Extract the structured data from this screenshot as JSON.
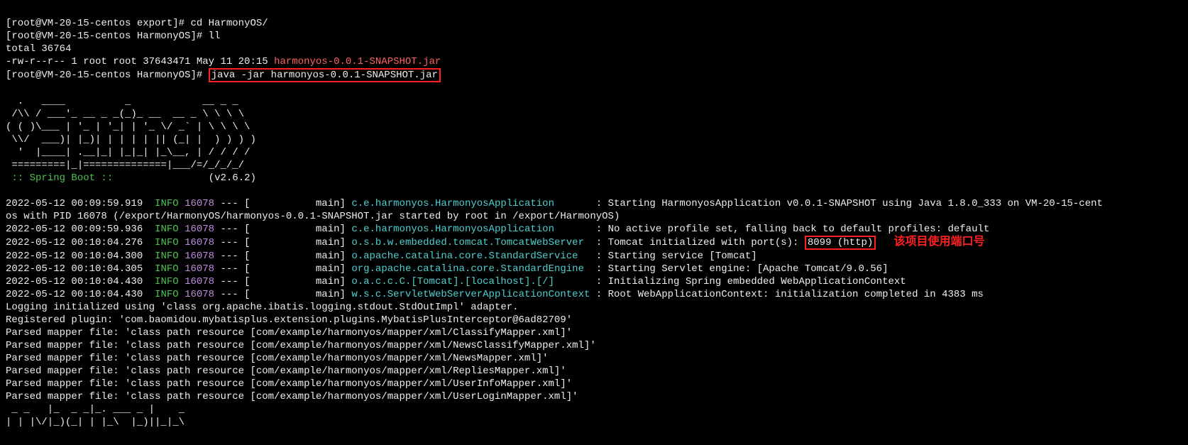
{
  "prompts": {
    "p1_prefix": "[root@VM-20-15-centos export]# ",
    "p1_cmd": "cd HarmonyOS/",
    "p2_prefix": "[root@VM-20-15-centos HarmonyOS]# ",
    "p2_cmd": "ll",
    "total": "total 36764",
    "ls_line_prefix": "-rw-r--r-- 1 root root 37643471 May 11 20:15 ",
    "ls_filename": "harmonyos-0.0.1-SNAPSHOT.jar",
    "p3_prefix": "[root@VM-20-15-centos HarmonyOS]# ",
    "p3_cmd": "java -jar harmonyos-0.0.1-SNAPSHOT.jar"
  },
  "ascii": {
    "l1": "  .   ____          _            __ _ _",
    "l2": " /\\\\ / ___'_ __ _ _(_)_ __  __ _ \\ \\ \\ \\",
    "l3": "( ( )\\___ | '_ | '_| | '_ \\/ _` | \\ \\ \\ \\",
    "l4": " \\\\/  ___)| |_)| | | | | || (_| |  ) ) ) )",
    "l5": "  '  |____| .__|_| |_|_| |_\\__, | / / / /",
    "l6": " =========|_|==============|___/=/_/_/_/"
  },
  "boot": {
    "label": " :: Spring Boot :: ",
    "spacer": "               ",
    "version": "(v2.6.2)"
  },
  "logs": [
    {
      "ts": "2022-05-12 00:09:59.919",
      "pid": "16078",
      "main": "main",
      "logger": "c.e.harmonyos.HarmonyosApplication      ",
      "msg_pre": ": Starting HarmonyosApplication v0.0.1-SNAPSHOT using Java 1.8.0_333 on VM-20-15-cent",
      "port": "",
      "msg_post": ""
    },
    {
      "cont": "os with PID 16078 (/export/HarmonyOS/harmonyos-0.0.1-SNAPSHOT.jar started by root in /export/HarmonyOS)"
    },
    {
      "ts": "2022-05-12 00:09:59.936",
      "pid": "16078",
      "main": "main",
      "logger": "c.e.harmonyos.HarmonyosApplication      ",
      "msg_pre": ": No active profile set, falling back to default profiles: default",
      "port": "",
      "msg_post": ""
    },
    {
      "ts": "2022-05-12 00:10:04.276",
      "pid": "16078",
      "main": "main",
      "logger": "o.s.b.w.embedded.tomcat.TomcatWebServer ",
      "msg_pre": ": Tomcat initialized with port(s): ",
      "port": "8099 (http)",
      "msg_post": "",
      "annot": "该项目使用端口号"
    },
    {
      "ts": "2022-05-12 00:10:04.300",
      "pid": "16078",
      "main": "main",
      "logger": "o.apache.catalina.core.StandardService  ",
      "msg_pre": ": Starting service [Tomcat]",
      "port": "",
      "msg_post": ""
    },
    {
      "ts": "2022-05-12 00:10:04.305",
      "pid": "16078",
      "main": "main",
      "logger": "org.apache.catalina.core.StandardEngine ",
      "msg_pre": ": Starting Servlet engine: [Apache Tomcat/9.0.56]",
      "port": "",
      "msg_post": ""
    },
    {
      "ts": "2022-05-12 00:10:04.430",
      "pid": "16078",
      "main": "main",
      "logger": "o.a.c.c.C.[Tomcat].[localhost].[/]      ",
      "msg_pre": ": Initializing Spring embedded WebApplicationContext",
      "port": "",
      "msg_post": ""
    },
    {
      "ts": "2022-05-12 00:10:04.430",
      "pid": "16078",
      "main": "main",
      "logger": "w.s.c.ServletWebServerApplicationContext",
      "msg_pre": ": Root WebApplicationContext: initialization completed in 4383 ms",
      "port": "",
      "msg_post": ""
    }
  ],
  "info_label": "INFO",
  "plain": [
    "Logging initialized using 'class org.apache.ibatis.logging.stdout.StdOutImpl' adapter.",
    "Registered plugin: 'com.baomidou.mybatisplus.extension.plugins.MybatisPlusInterceptor@6ad82709'",
    "Parsed mapper file: 'class path resource [com/example/harmonyos/mapper/xml/ClassifyMapper.xml]'",
    "Parsed mapper file: 'class path resource [com/example/harmonyos/mapper/xml/NewsClassifyMapper.xml]'",
    "Parsed mapper file: 'class path resource [com/example/harmonyos/mapper/xml/NewsMapper.xml]'",
    "Parsed mapper file: 'class path resource [com/example/harmonyos/mapper/xml/RepliesMapper.xml]'",
    "Parsed mapper file: 'class path resource [com/example/harmonyos/mapper/xml/UserInfoMapper.xml]'",
    "Parsed mapper file: 'class path resource [com/example/harmonyos/mapper/xml/UserLoginMapper.xml]'"
  ],
  "mybatis_ascii": {
    "l1": " _ _   |_  _ _|_. ___ _ |    _ ",
    "l2": "| | |\\/|_)(_| | |_\\  |_)||_|_\\ "
  }
}
